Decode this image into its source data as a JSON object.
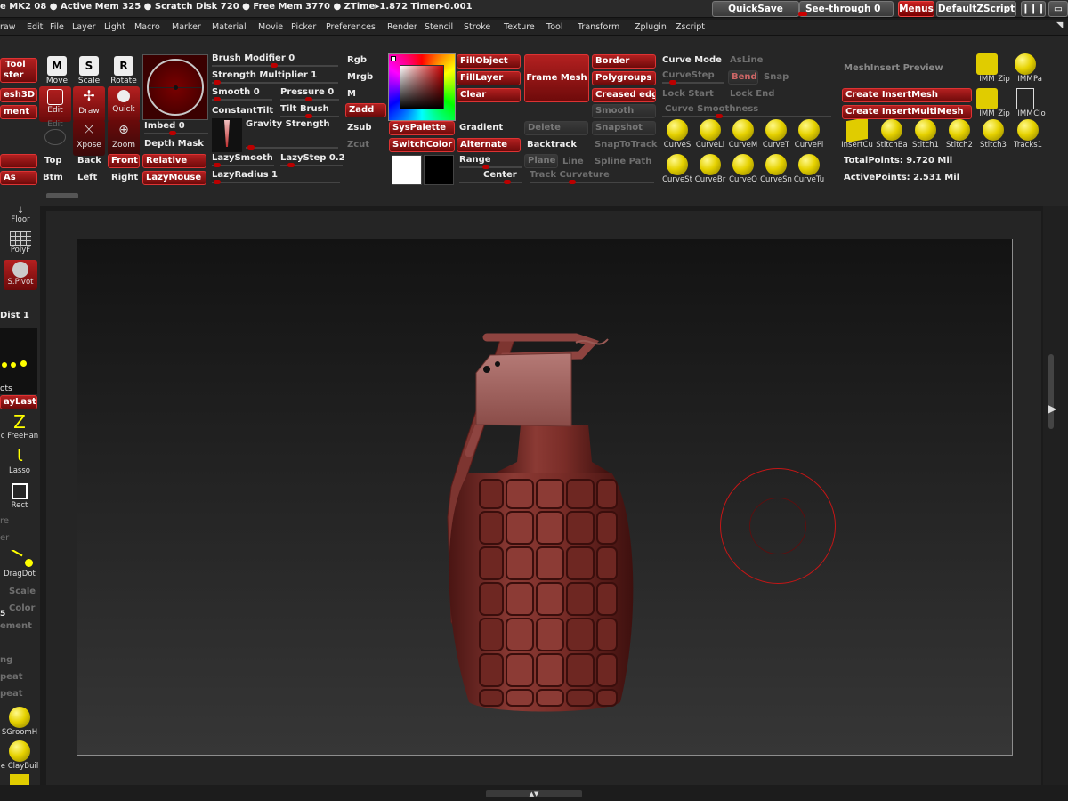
{
  "status": {
    "text": "e MK2 08  ●  Active Mem 325  ●  Scratch Disk 720  ●  Free Mem 3770  ●  ZTime▸1.872  Timer▸0.001"
  },
  "top_buttons": {
    "quicksave": "QuickSave",
    "seethrough": "See-through   0",
    "menus": "Menus",
    "script": "DefaultZScript"
  },
  "menus": [
    "raw",
    "Edit",
    "File",
    "Layer",
    "Light",
    "Macro",
    "Marker",
    "Material",
    "Movie",
    "Picker",
    "Preferences",
    "Render",
    "Stencil",
    "Stroke",
    "Texture",
    "Tool",
    "Transform",
    "Zplugin",
    "Zscript"
  ],
  "shelf": {
    "tool": "Tool",
    "ster": "ster",
    "mesh3d": "esh3D",
    "ment": "ment",
    "move": "Move",
    "scale": "Scale",
    "rotate": "Rotate",
    "edit": "Edit",
    "draw": "Draw",
    "quick": "Quick",
    "edit2": "Edit",
    "xpose": "Xpose",
    "zoom": "Zoom",
    "top": "Top",
    "back": "Back",
    "front": "Front",
    "relative": "Relative",
    "as": "As",
    "btm": "Btm",
    "left": "Left",
    "right": "Right",
    "lazymouse": "LazyMouse",
    "brush_modifier": "Brush Modifier 0",
    "strength_multiplier": "Strength Multiplier 1",
    "smooth": "Smooth 0",
    "pressure": "Pressure 0",
    "constanttilt": "ConstantTilt",
    "tiltbrush": "Tilt Brush",
    "imbed": "Imbed 0",
    "gravity": "Gravity Strength",
    "depthmask": "Depth Mask",
    "lazysmooth": "LazySmooth",
    "lazystep": "LazyStep 0.2",
    "lazyradius": "LazyRadius 1",
    "rgb": "Rgb",
    "mrgb": "Mrgb",
    "m": "M",
    "zadd": "Zadd",
    "zsub": "Zsub",
    "zcut": "Zcut",
    "syspalette": "SysPalette",
    "switchcolor": "SwitchColor",
    "fillobject": "FillObject",
    "filllayer": "FillLayer",
    "clear": "Clear",
    "framemesh": "Frame Mesh",
    "gradient": "Gradient",
    "alternate": "Alternate",
    "range": "Range",
    "center": "Center",
    "delete": "Delete",
    "backtrack": "Backtrack",
    "plane": "Plane",
    "line": "Line",
    "track_curvature": "Track Curvature",
    "border": "Border",
    "polygroups": "Polygroups",
    "creased": "Creased edg",
    "smooth2": "Smooth",
    "snapshot": "Snapshot",
    "snaptotrack": "SnapToTrack",
    "splinepath": "Spline Path",
    "curvemode": "Curve Mode",
    "asline": "AsLine",
    "curvestep": "CurveStep",
    "bend": "Bend",
    "snap": "Snap",
    "lockstart": "Lock Start",
    "lockend": "Lock End",
    "curve_smoothness": "Curve  Smoothness",
    "curve_icons_row1": [
      "CurveS",
      "CurveLi",
      "CurveM",
      "CurveT",
      "CurvePi"
    ],
    "curve_icons_row2": [
      "CurveSt",
      "CurveBr",
      "CurveQ",
      "CurveSn",
      "CurveTu"
    ],
    "meshinsert_preview": "MeshInsert  Preview",
    "create_insertmesh": "Create InsertMesh",
    "create_insertmultimesh": "Create InsertMultiMesh",
    "imm_row1": [
      "IMM",
      "Zip",
      "IMM",
      "Pa"
    ],
    "imm_row2": [
      "IMM",
      "Zip",
      "IMM",
      "Clo"
    ],
    "stitch_icons": [
      "InsertCu",
      "StitchBa",
      "Stitch1",
      "Stitch2",
      "Stitch3",
      "Tracks1"
    ],
    "totalpoints": "TotalPoints: 9.720  Mil",
    "activepoints": "ActivePoints: 2.531  Mil"
  },
  "left": {
    "floor": "Floor",
    "polyf": "PolyF",
    "spivot": "S.Pivot",
    "dist": "Dist 1",
    "dots": "ots",
    "claylast": "ayLast",
    "freehand": "c FreeHan",
    "lasso": "Lasso",
    "rect": "Rect",
    "re": "re",
    "er": "er",
    "dragdot": "DragDot",
    "scale": "Scale",
    "color": "Color",
    "s": "5",
    "ement": "ement",
    "ng": "ng",
    "peat1": "peat",
    "peat2": "peat",
    "groomh": "SGroomH",
    "claybuild": "e ClayBuil"
  },
  "colors": {
    "accent": "#b01818",
    "bg": "#1b1b1b",
    "model": "#7a2e2a",
    "highlight_yellow": "#f0e000"
  }
}
